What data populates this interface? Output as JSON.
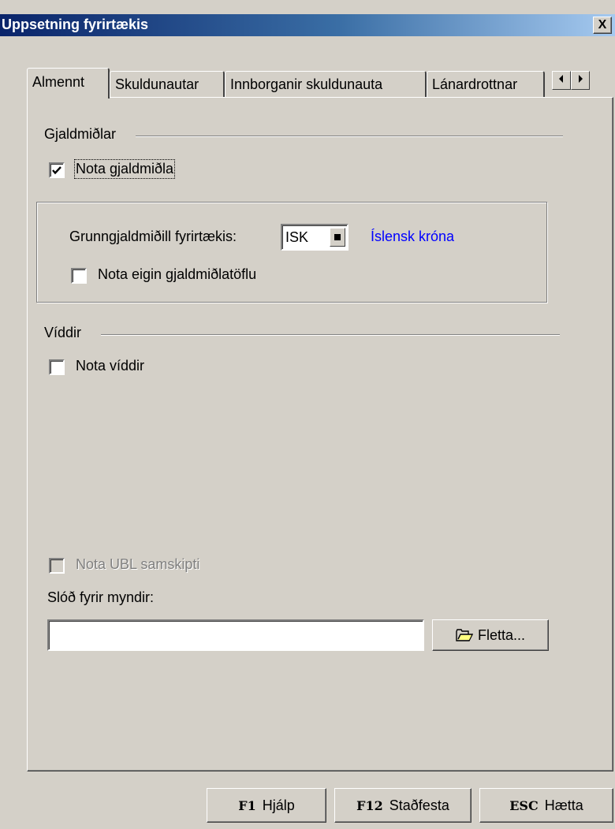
{
  "window": {
    "title": "Uppsetning fyrirtækis",
    "close_label": "X"
  },
  "tabs": [
    {
      "label": "Almennt",
      "active": true
    },
    {
      "label": "Skuldunautar",
      "active": false
    },
    {
      "label": "Innborganir skuldunauta",
      "active": false
    },
    {
      "label": "Lánardrottnar",
      "active": false
    }
  ],
  "general": {
    "currency_section": "Gjaldmiðlar",
    "use_currency": {
      "label": "Nota gjaldmiðla",
      "checked": true
    },
    "base_currency_label": "Grunngjaldmiðill fyrirtækis:",
    "base_currency_value": "ISK",
    "base_currency_name": "Íslensk króna",
    "own_rate_table": {
      "label": "Nota eigin gjaldmiðlatöflu",
      "checked": false
    },
    "dimensions_section": "Víddir",
    "use_dimensions": {
      "label": "Nota víddir",
      "checked": false
    },
    "use_ubl": {
      "label": "Nota UBL samskipti",
      "checked": false,
      "enabled": false
    },
    "image_path_label": "Slóð fyrir myndir:",
    "image_path_value": "",
    "browse_label": "Fletta..."
  },
  "footer": {
    "help": {
      "key": "F1",
      "label": "Hjálp"
    },
    "confirm": {
      "key": "F12",
      "label": "Staðfesta"
    },
    "cancel": {
      "key": "ESC",
      "label": "Hætta"
    }
  },
  "icons": {
    "close": "close-icon",
    "scroll_left": "arrow-left-icon",
    "scroll_right": "arrow-right-icon",
    "folder": "folder-open-icon",
    "check": "check-icon"
  },
  "colors": {
    "title_bar": "#0a246a",
    "link": "#0000ff",
    "face": "#d4d0c8"
  }
}
